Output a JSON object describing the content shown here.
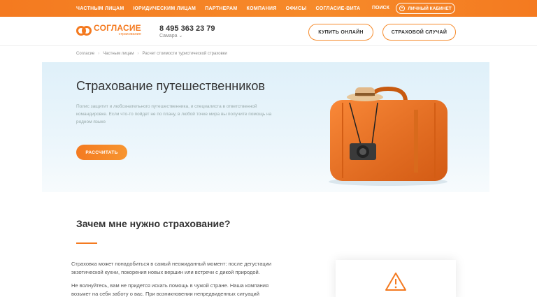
{
  "topbar": {
    "nav": [
      "ЧАСТНЫМ ЛИЦАМ",
      "ЮРИДИЧЕСКИМ ЛИЦАМ",
      "ПАРТНЕРАМ",
      "КОМПАНИЯ",
      "ОФИСЫ",
      "СОГЛАСИЕ-ВИТА"
    ],
    "search": "ПОИСК",
    "cabinet": "ЛИЧНЫЙ КАБИНЕТ"
  },
  "header": {
    "logo_name": "СОГЛАСИЕ",
    "logo_sub": "страхование",
    "phone": "8 495 363 23 79",
    "city": "Самара ⌄",
    "buy_online": "КУПИТЬ ОНЛАЙН",
    "insurance_case": "СТРАХОВОЙ СЛУЧАЙ"
  },
  "breadcrumb": [
    "Согласие",
    "Частным лицам",
    "Расчет стоимости туристической страховки"
  ],
  "hero": {
    "title": "Страхование путешественников",
    "description": "Полис защитит и любознательного путешественника, и специалиста в ответственной командировке. Если что-то пойдет не по плану, в любой точке мира вы получите помощь на родном языке",
    "calc_button": "РАССЧИТАТЬ"
  },
  "why": {
    "title": "Зачем мне нужно страхование?",
    "p1": "Страховка может понадобиться в самый неожиданный момент: после дегустации экзотической кухни, покорения новых вершин или встречи с дикой природой.",
    "p2": "Не волнуйтесь, вам не придется искать помощь в чужой стране. Наша компания возьмет на себя заботу о вас. При возникновении непредвиденных ситуаций"
  },
  "colors": {
    "accent": "#f47a20",
    "hero_bg": "#dff0f9"
  },
  "icons": [
    "user-icon",
    "chevron-down-icon",
    "warning-icon"
  ]
}
